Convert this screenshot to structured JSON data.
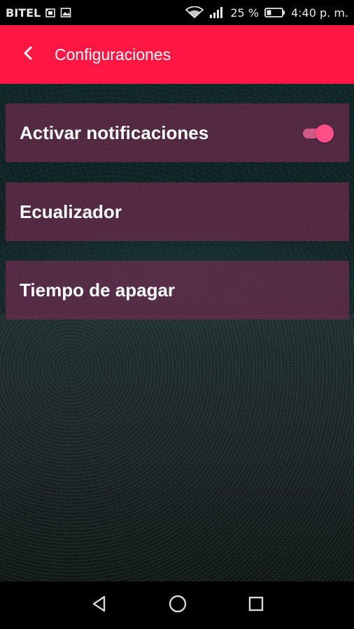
{
  "status_bar": {
    "carrier": "BITEL",
    "battery_percent": "25 %",
    "time": "4:40 p. m.",
    "icons": [
      "sim-card-icon",
      "image-icon",
      "wifi-icon",
      "signal-icon",
      "battery-icon"
    ]
  },
  "app_bar": {
    "title": "Configuraciones",
    "back_icon": "chevron-left-icon",
    "background_color": "#ff1744"
  },
  "settings": {
    "items": [
      {
        "label": "Activar notificaciones",
        "has_toggle": true,
        "toggle_on": true
      },
      {
        "label": "Ecualizador"
      },
      {
        "label": "Tiempo de apagar"
      }
    ]
  },
  "nav_bar": {
    "icons": [
      "back-triangle-icon",
      "home-circle-icon",
      "recents-square-icon"
    ]
  },
  "colors": {
    "accent": "#ff1744",
    "item_background": "#6e2c4e",
    "toggle_on": "#ff4f86"
  }
}
